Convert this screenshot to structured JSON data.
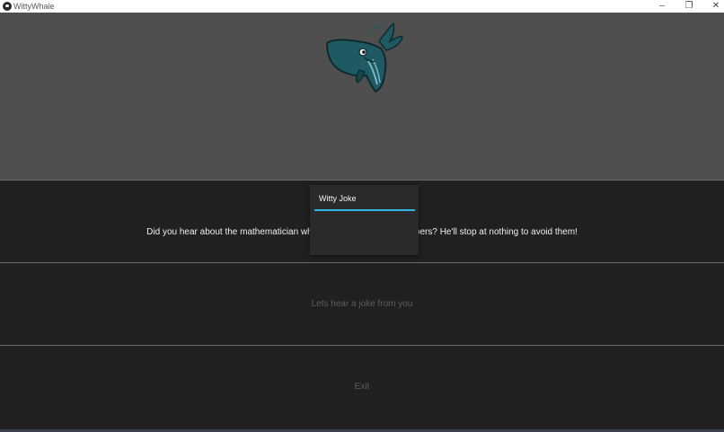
{
  "window": {
    "title": "WittyWhale",
    "controls": {
      "minimize": "–",
      "maximize": "❐",
      "close": "✕"
    }
  },
  "banner": {
    "image": "whale-logo-icon"
  },
  "panels": {
    "joke_text": "Did you hear about the mathematician who's afraid of negative numbers? He'll stop at nothing to avoid them!",
    "ask_label": "Lets hear a joke from you",
    "exit_label": "Exit"
  },
  "popup": {
    "title": "Witty Joke"
  },
  "colors": {
    "banner_bg": "#4f4f4f",
    "panel_bg": "#202020",
    "accent": "#33b5e5",
    "whale_body": "#1f5961"
  }
}
